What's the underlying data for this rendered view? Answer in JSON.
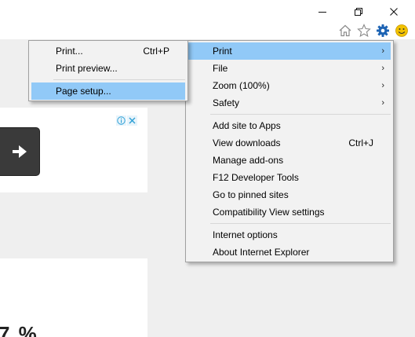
{
  "window": {
    "controls": [
      "minimize-icon",
      "restore-icon",
      "close-icon"
    ]
  },
  "toolbar": {
    "icons": [
      "home-icon",
      "favorites-star-icon",
      "tools-gear-icon",
      "smiley-feedback-icon"
    ],
    "gear_color": "#1e64b4",
    "smiley_color": "#f2c200"
  },
  "page": {
    "ad_badges": [
      "info-icon",
      "close-icon"
    ],
    "big_text": "7 %"
  },
  "tools_menu": {
    "items": [
      {
        "label": "Print",
        "accel": "",
        "submenu": true,
        "highlighted": true
      },
      {
        "label": "File",
        "accel": "",
        "submenu": true
      },
      {
        "label": "Zoom (100%)",
        "accel": "",
        "submenu": true
      },
      {
        "label": "Safety",
        "accel": "",
        "submenu": true
      }
    ],
    "group2": [
      {
        "label": "Add site to Apps",
        "accel": ""
      },
      {
        "label": "View downloads",
        "accel": "Ctrl+J"
      },
      {
        "label": "Manage add-ons",
        "accel": ""
      },
      {
        "label": "F12 Developer Tools",
        "accel": ""
      },
      {
        "label": "Go to pinned sites",
        "accel": ""
      },
      {
        "label": "Compatibility View settings",
        "accel": ""
      }
    ],
    "group3": [
      {
        "label": "Internet options",
        "accel": ""
      },
      {
        "label": "About Internet Explorer",
        "accel": ""
      }
    ]
  },
  "print_submenu": {
    "items": [
      {
        "label": "Print...",
        "accel": "Ctrl+P"
      },
      {
        "label": "Print preview...",
        "accel": ""
      }
    ],
    "group2": [
      {
        "label": "Page setup...",
        "accel": "",
        "highlighted": true
      }
    ]
  },
  "colors": {
    "highlight": "#91c9f7",
    "menu_bg": "#f2f2f2"
  }
}
